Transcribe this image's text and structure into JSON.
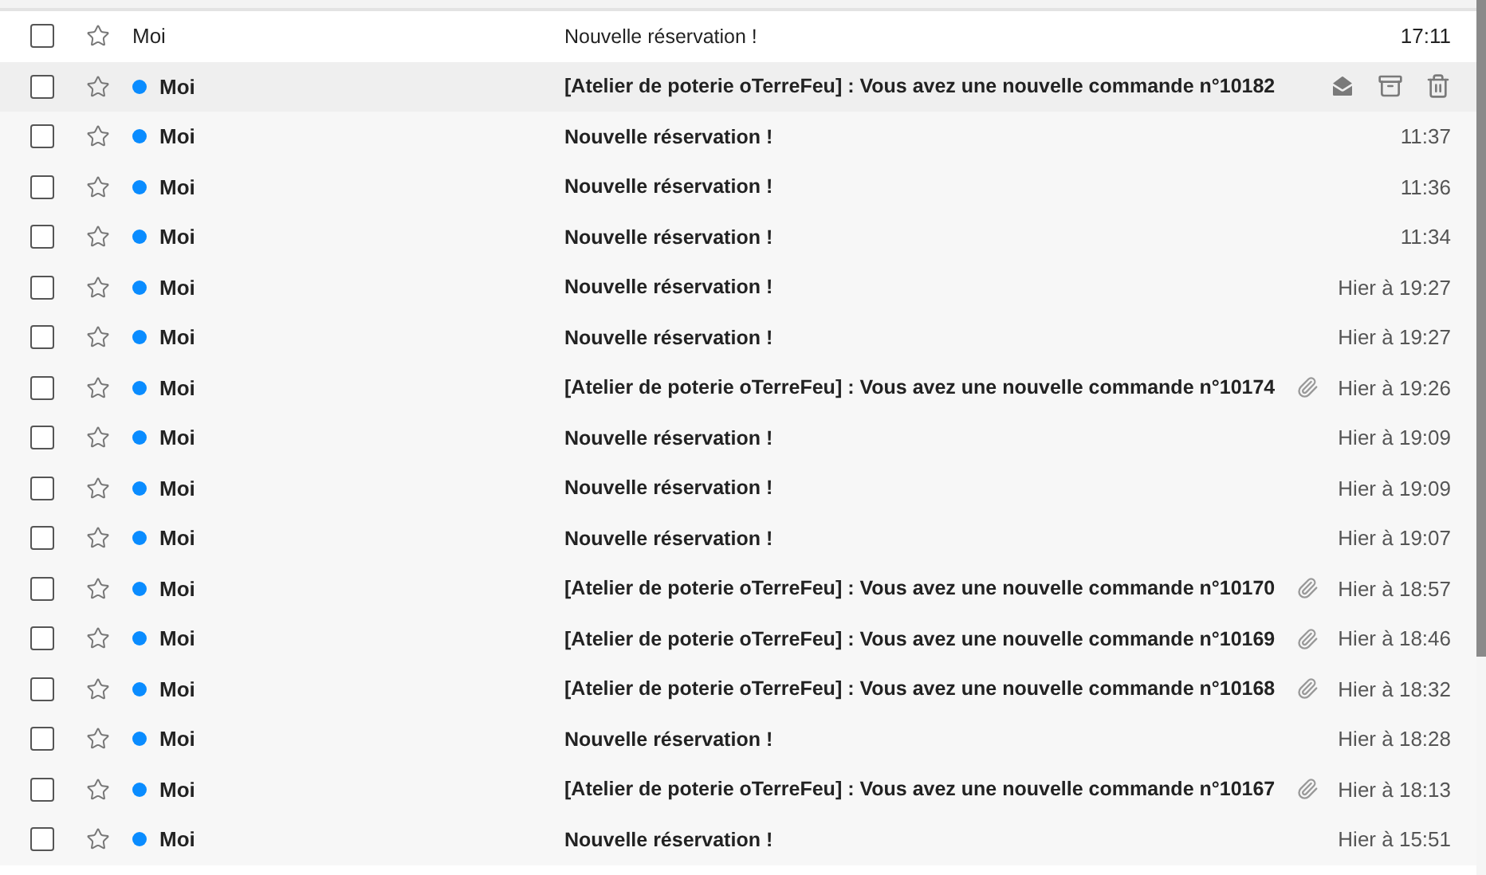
{
  "messages": [
    {
      "sender": "Moi",
      "subject": "Nouvelle réservation !",
      "time": "17:11",
      "unread": false,
      "hovered": false,
      "attachment": false
    },
    {
      "sender": "Moi",
      "subject": "[Atelier de poterie oTerreFeu] : Vous avez une nouvelle commande n°10182",
      "unread": true,
      "hovered": true,
      "attachment": false
    },
    {
      "sender": "Moi",
      "subject": "Nouvelle réservation !",
      "time": "11:37",
      "unread": true,
      "hovered": false,
      "attachment": false
    },
    {
      "sender": "Moi",
      "subject": "Nouvelle réservation !",
      "time": "11:36",
      "unread": true,
      "hovered": false,
      "attachment": false
    },
    {
      "sender": "Moi",
      "subject": "Nouvelle réservation !",
      "time": "11:34",
      "unread": true,
      "hovered": false,
      "attachment": false
    },
    {
      "sender": "Moi",
      "subject": "Nouvelle réservation !",
      "time": "Hier à 19:27",
      "unread": true,
      "hovered": false,
      "attachment": false
    },
    {
      "sender": "Moi",
      "subject": "Nouvelle réservation !",
      "time": "Hier à 19:27",
      "unread": true,
      "hovered": false,
      "attachment": false
    },
    {
      "sender": "Moi",
      "subject": "[Atelier de poterie oTerreFeu] : Vous avez une nouvelle commande n°10174",
      "time": "Hier à 19:26",
      "unread": true,
      "hovered": false,
      "attachment": true
    },
    {
      "sender": "Moi",
      "subject": "Nouvelle réservation !",
      "time": "Hier à 19:09",
      "unread": true,
      "hovered": false,
      "attachment": false
    },
    {
      "sender": "Moi",
      "subject": "Nouvelle réservation !",
      "time": "Hier à 19:09",
      "unread": true,
      "hovered": false,
      "attachment": false
    },
    {
      "sender": "Moi",
      "subject": "Nouvelle réservation !",
      "time": "Hier à 19:07",
      "unread": true,
      "hovered": false,
      "attachment": false
    },
    {
      "sender": "Moi",
      "subject": "[Atelier de poterie oTerreFeu] : Vous avez une nouvelle commande n°10170",
      "time": "Hier à 18:57",
      "unread": true,
      "hovered": false,
      "attachment": true
    },
    {
      "sender": "Moi",
      "subject": "[Atelier de poterie oTerreFeu] : Vous avez une nouvelle commande n°10169",
      "time": "Hier à 18:46",
      "unread": true,
      "hovered": false,
      "attachment": true
    },
    {
      "sender": "Moi",
      "subject": "[Atelier de poterie oTerreFeu] : Vous avez une nouvelle commande n°10168",
      "time": "Hier à 18:32",
      "unread": true,
      "hovered": false,
      "attachment": true
    },
    {
      "sender": "Moi",
      "subject": "Nouvelle réservation !",
      "time": "Hier à 18:28",
      "unread": true,
      "hovered": false,
      "attachment": false
    },
    {
      "sender": "Moi",
      "subject": "[Atelier de poterie oTerreFeu] : Vous avez une nouvelle commande n°10167",
      "time": "Hier à 18:13",
      "unread": true,
      "hovered": false,
      "attachment": true
    },
    {
      "sender": "Moi",
      "subject": "Nouvelle réservation !",
      "time": "Hier à 15:51",
      "unread": true,
      "hovered": false,
      "attachment": false
    }
  ]
}
